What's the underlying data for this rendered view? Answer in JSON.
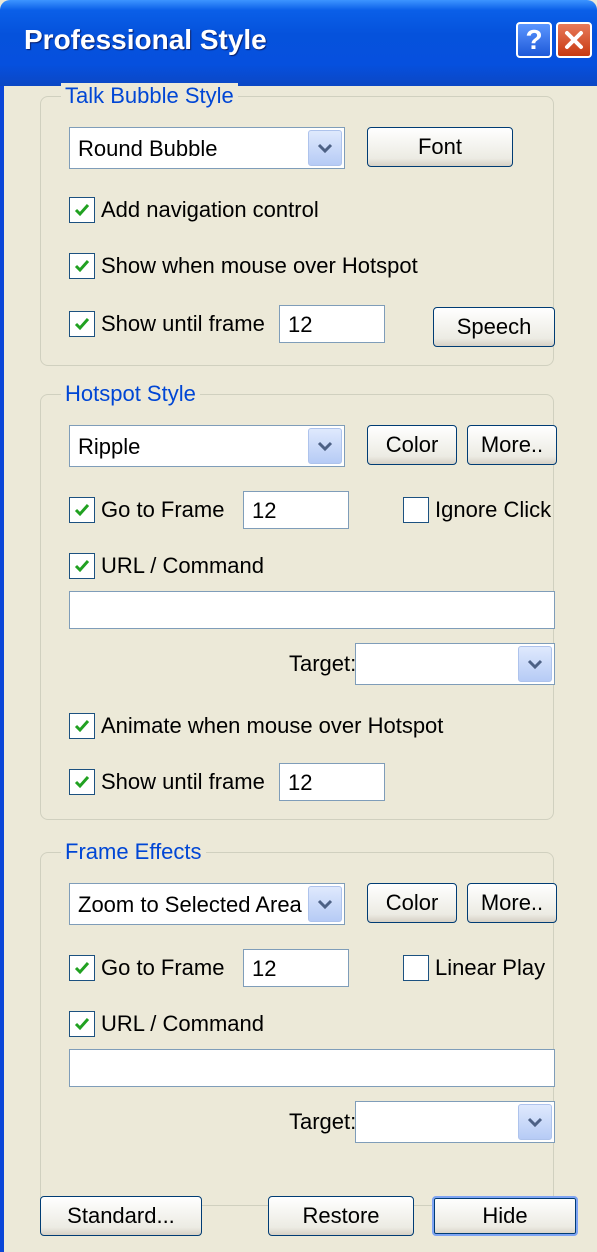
{
  "window": {
    "title": "Professional Style"
  },
  "talk_bubble": {
    "legend": "Talk Bubble Style",
    "style_value": "Round Bubble",
    "font_label": "Font",
    "add_navigation": {
      "label": "Add navigation control",
      "checked": true
    },
    "show_on_hover": {
      "label": "Show when mouse over Hotspot",
      "checked": true
    },
    "show_until": {
      "label": "Show until frame",
      "checked": true,
      "value": "12"
    },
    "speech_label": "Speech"
  },
  "hotspot": {
    "legend": "Hotspot Style",
    "style_value": "Ripple",
    "color_label": "Color",
    "more_label": "More..",
    "go_to_frame": {
      "label": "Go to Frame",
      "checked": true,
      "value": "12"
    },
    "ignore_click": {
      "label": "Ignore Click",
      "checked": false
    },
    "url_command": {
      "label": "URL / Command",
      "checked": true,
      "value": ""
    },
    "target": {
      "label": "Target:",
      "value": ""
    },
    "animate_on_hover": {
      "label": "Animate when mouse over Hotspot",
      "checked": true
    },
    "show_until": {
      "label": "Show until frame",
      "checked": true,
      "value": "12"
    }
  },
  "frame_effects": {
    "legend": "Frame Effects",
    "effect_value": "Zoom to Selected Area",
    "color_label": "Color",
    "more_label": "More..",
    "go_to_frame": {
      "label": "Go to Frame",
      "checked": true,
      "value": "12"
    },
    "linear_play": {
      "label": "Linear Play",
      "checked": false
    },
    "url_command": {
      "label": "URL / Command",
      "checked": true,
      "value": ""
    },
    "target": {
      "label": "Target:",
      "value": ""
    }
  },
  "footer": {
    "standard_label": "Standard...",
    "restore_label": "Restore",
    "hide_label": "Hide"
  },
  "icons": {
    "check": "check-icon",
    "dropdown": "chevron-down-icon",
    "help": "help-icon",
    "close": "close-icon"
  },
  "colors": {
    "title_bar": "#0552dc",
    "legend_text": "#0046d5",
    "dialog_bg": "#ece9d8",
    "check_mark": "#21a121"
  }
}
